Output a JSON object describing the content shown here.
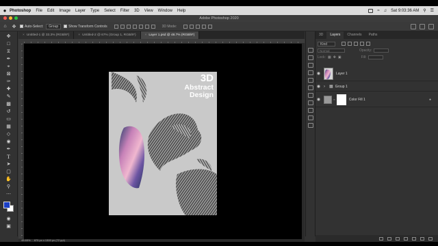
{
  "menubar": {
    "apple": "",
    "app_name": "Photoshop",
    "items": [
      "File",
      "Edit",
      "Image",
      "Layer",
      "Type",
      "Select",
      "Filter",
      "3D",
      "View",
      "Window",
      "Help"
    ],
    "clock": "Sat 9:03:36 AM"
  },
  "window": {
    "title": "Adobe Photoshop 2020"
  },
  "options": {
    "auto_select_label": "Auto-Select:",
    "auto_select_value": "Group",
    "transform_label": "Show Transform Controls",
    "mode_3d": "3D Mode:"
  },
  "tabs": [
    {
      "label": "Untitled-1 @ 33.3% (RGB/8*)"
    },
    {
      "label": "Untitled-2 @ 67% (Group 1, RGB/8*)"
    },
    {
      "label": "Layer 1.psd @ 48.7% (RGB/8*)"
    }
  ],
  "document": {
    "title_line1": "3D",
    "title_line2": "Abstract",
    "title_line3": "Design"
  },
  "status": {
    "zoom": "48.65%",
    "dimensions": "875 px x 1300 px (72 ppi)"
  },
  "panels": {
    "tabs": [
      "3D",
      "Layers",
      "Channels",
      "Paths"
    ],
    "filter_kind": "Kind",
    "mode_label": "Normal",
    "opacity_label": "Opacity:",
    "lock_label": "Lock:",
    "fill_label": "Fill:"
  },
  "layers": [
    {
      "name": "Layer 1"
    },
    {
      "name": "Group 1"
    },
    {
      "name": "Color Fill 1"
    }
  ],
  "colors": {
    "foreground": "#1b3fc4",
    "background": "#ffffff",
    "document_bg": "#c9c9c9"
  }
}
